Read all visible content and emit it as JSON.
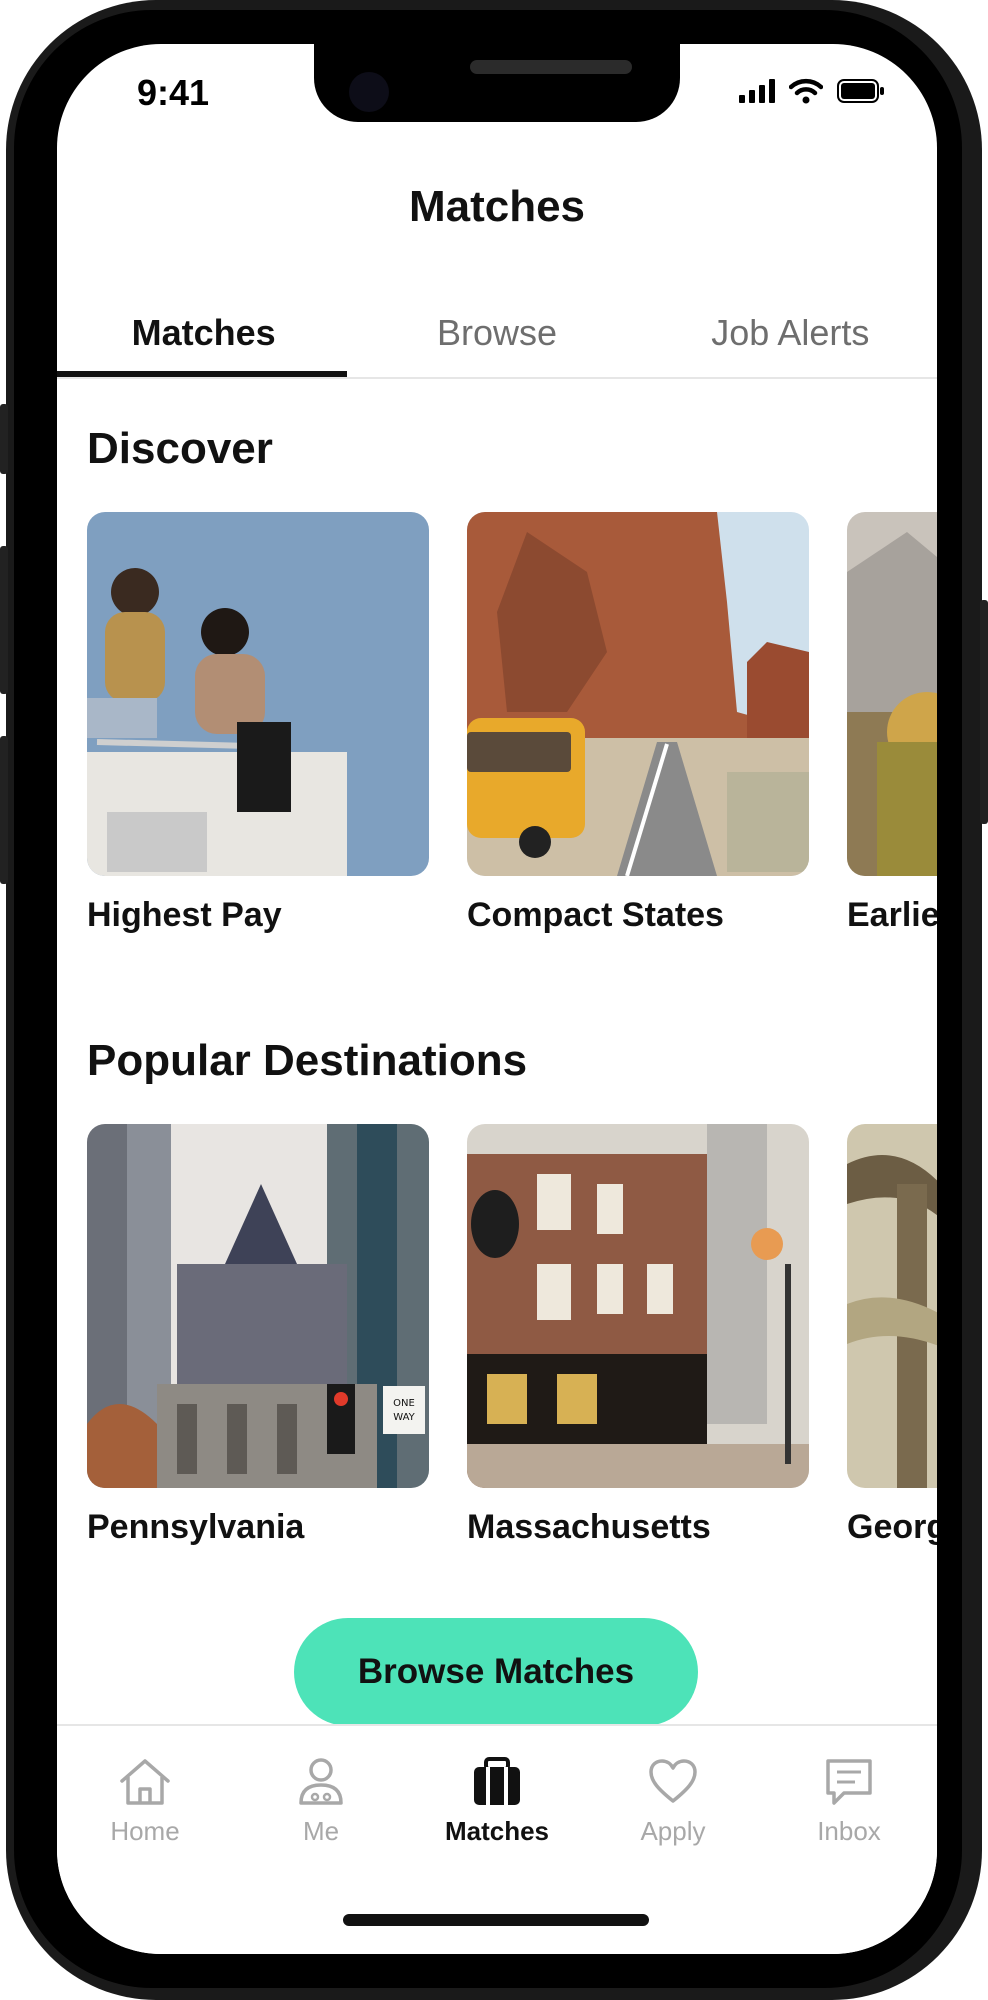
{
  "status": {
    "time": "9:41"
  },
  "header": {
    "title": "Matches"
  },
  "tabs": [
    {
      "label": "Matches"
    },
    {
      "label": "Browse"
    },
    {
      "label": "Job Alerts"
    }
  ],
  "discover": {
    "title": "Discover",
    "cards": [
      {
        "label": "Highest Pay"
      },
      {
        "label": "Compact States"
      },
      {
        "label": "Earlie"
      }
    ]
  },
  "destinations": {
    "title": "Popular Destinations",
    "cards": [
      {
        "label": "Pennsylvania"
      },
      {
        "label": "Massachusetts"
      },
      {
        "label": "Georg"
      }
    ],
    "sign_text": "ONE WAY"
  },
  "cta": {
    "label": "Browse Matches"
  },
  "tabbar": [
    {
      "label": "Home",
      "icon": "home-icon"
    },
    {
      "label": "Me",
      "icon": "person-icon"
    },
    {
      "label": "Matches",
      "icon": "briefcase-icon"
    },
    {
      "label": "Apply",
      "icon": "heart-icon"
    },
    {
      "label": "Inbox",
      "icon": "message-icon"
    }
  ],
  "colors": {
    "accent": "#4de3b8",
    "text": "#111111",
    "muted": "#a8a8a8"
  }
}
